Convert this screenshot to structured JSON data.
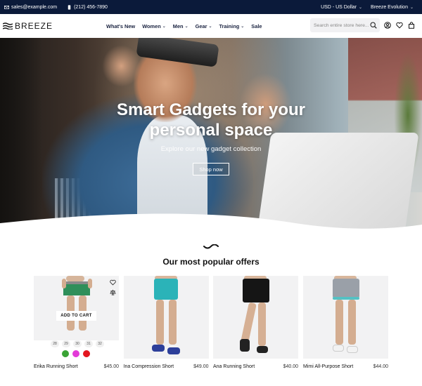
{
  "topbar": {
    "email": "sales@example.com",
    "phone": "(212) 456-7890",
    "currency": "USD - US Dollar",
    "store": "Breeze Evolution"
  },
  "header": {
    "logo": "BREEZE",
    "nav": [
      "What's New",
      "Women",
      "Men",
      "Gear",
      "Training",
      "Sale"
    ],
    "search_placeholder": "Search entire store here..."
  },
  "hero": {
    "title_line1": "Smart Gadgets for your",
    "title_line2": "personal space",
    "subtitle": "Explore our new gadget collection",
    "button": "Shop now"
  },
  "section": {
    "title": "Our most popular offers"
  },
  "products": [
    {
      "name": "Erika Running Short",
      "price": "$45.00",
      "add_to_cart": "ADD TO CART",
      "sizes": [
        "28",
        "29",
        "30",
        "31",
        "32"
      ],
      "swatches": [
        "#3aa335",
        "#e33ad8",
        "#e3161f"
      ]
    },
    {
      "name": "Ina Compression Short",
      "price": "$49.00"
    },
    {
      "name": "Ana Running Short",
      "price": "$40.00"
    },
    {
      "name": "Mimi All-Purpose Short",
      "price": "$44.00"
    }
  ],
  "colors": {
    "topbar_bg": "#0b1a3a",
    "nav_text": "#1a2340"
  }
}
